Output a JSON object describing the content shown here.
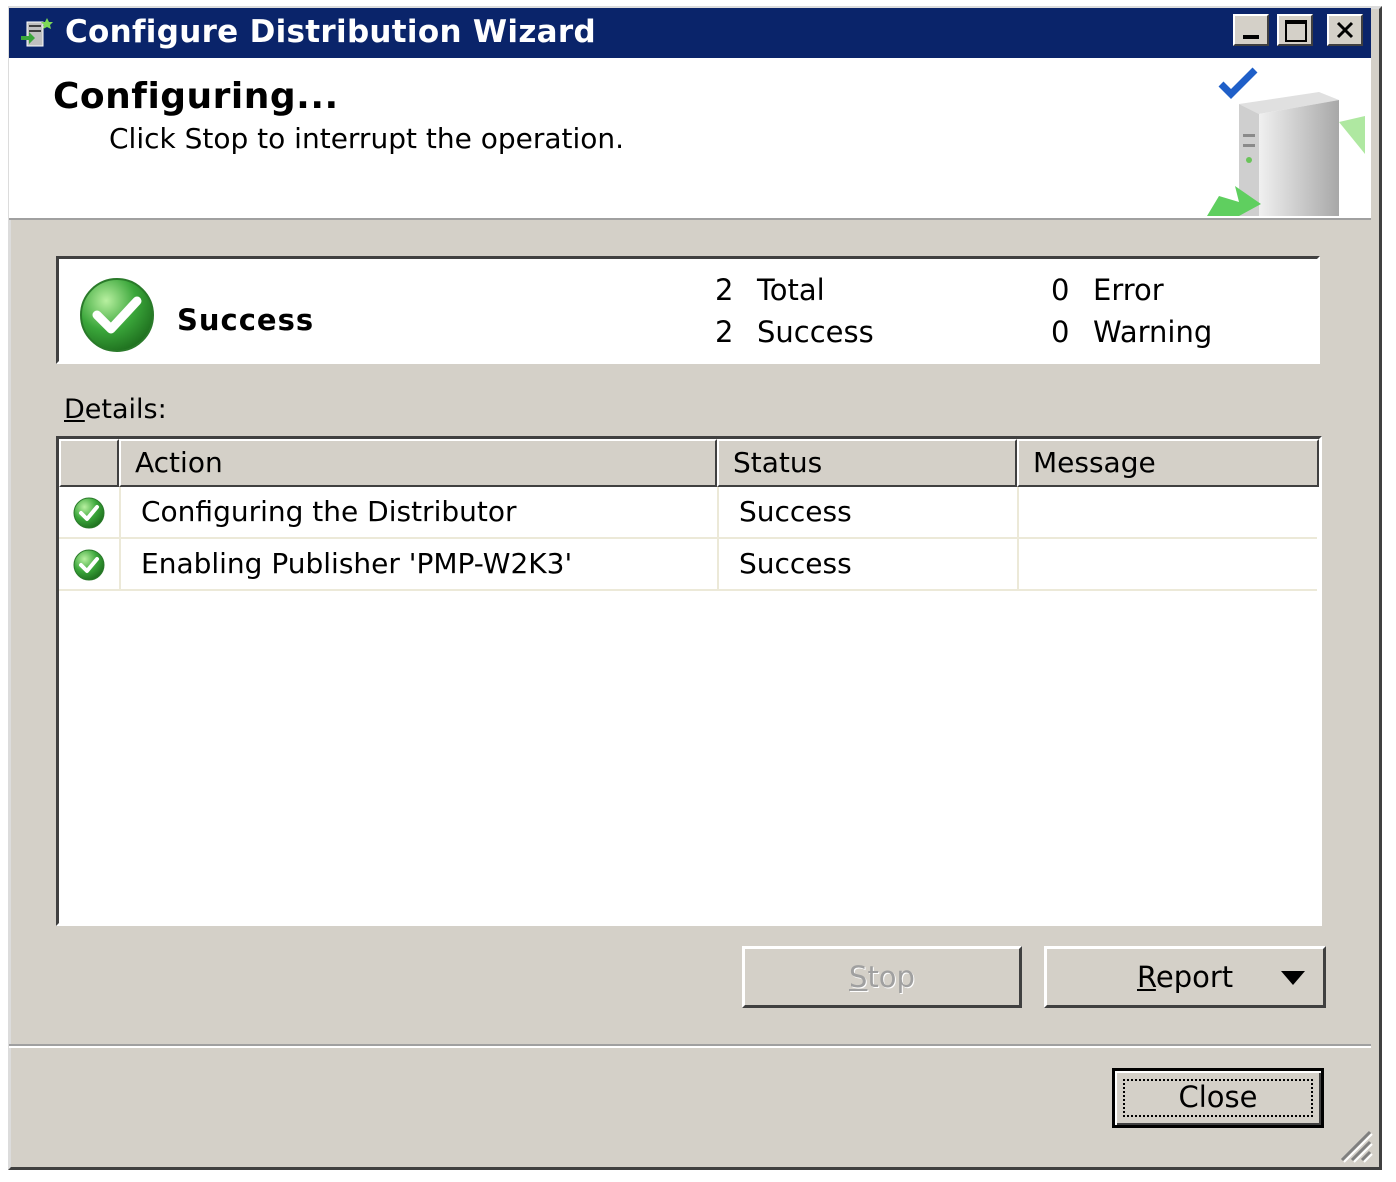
{
  "window": {
    "title": "Configure Distribution Wizard",
    "controls": {
      "minimize": "minimize-icon",
      "maximize": "maximize-icon",
      "close": "close-icon"
    }
  },
  "header": {
    "title": "Configuring...",
    "subtitle": "Click Stop to interrupt the operation.",
    "art_icon": "server-check-icon"
  },
  "summary": {
    "status": "Success",
    "status_icon": "success-check-icon",
    "total_count": "2",
    "total_label": "Total",
    "success_count": "2",
    "success_label": "Success",
    "error_count": "0",
    "error_label": "Error",
    "warning_count": "0",
    "warning_label": "Warning"
  },
  "details": {
    "label_mnemonic": "D",
    "label_rest": "etails:",
    "columns": [
      "Action",
      "Status",
      "Message"
    ],
    "rows": [
      {
        "action": "Configuring the Distributor",
        "status": "Success",
        "message": ""
      },
      {
        "action": "Enabling Publisher 'PMP-W2K3'",
        "status": "Success",
        "message": ""
      }
    ]
  },
  "buttons": {
    "stop_mnemonic": "S",
    "stop_rest": "top",
    "report_mnemonic": "R",
    "report_rest": "eport",
    "close": "Close"
  },
  "colors": {
    "titlebar": "#0a246a",
    "face": "#d4d0c8",
    "success_green": "#3aa63a"
  }
}
